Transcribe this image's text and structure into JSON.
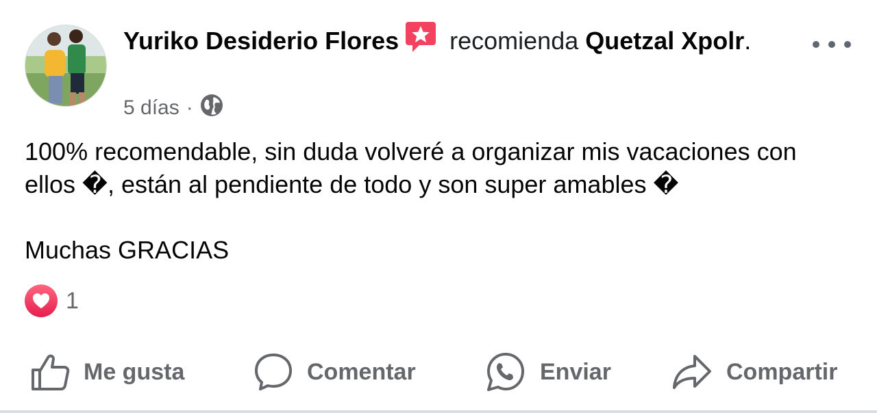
{
  "post": {
    "author_name": "Yuriko Desiderio Flores",
    "verb": "recomienda",
    "page_name": "Quetzal Xpolr",
    "period": ".",
    "time_ago": "5 días",
    "separator": "·",
    "audience_icon": "globe-icon",
    "body_line1": "100% recomendable, sin duda volveré a organizar mis vacaciones con ellos �, están al pendiente de todo y son super amables �",
    "body_line2": "Muchas GRACIAS",
    "reaction_icon": "heart-reaction-icon",
    "reaction_count": "1"
  },
  "actions": {
    "like": {
      "label": "Me gusta",
      "icon": "thumbs-up-icon"
    },
    "comment": {
      "label": "Comentar",
      "icon": "comment-bubble-icon"
    },
    "send": {
      "label": "Enviar",
      "icon": "whatsapp-icon"
    },
    "share": {
      "label": "Compartir",
      "icon": "share-arrow-icon"
    }
  },
  "colors": {
    "text_primary": "#050505",
    "text_secondary": "#65676b",
    "recommend_badge": "#f3425f",
    "love_reaction": "#f33e58"
  }
}
